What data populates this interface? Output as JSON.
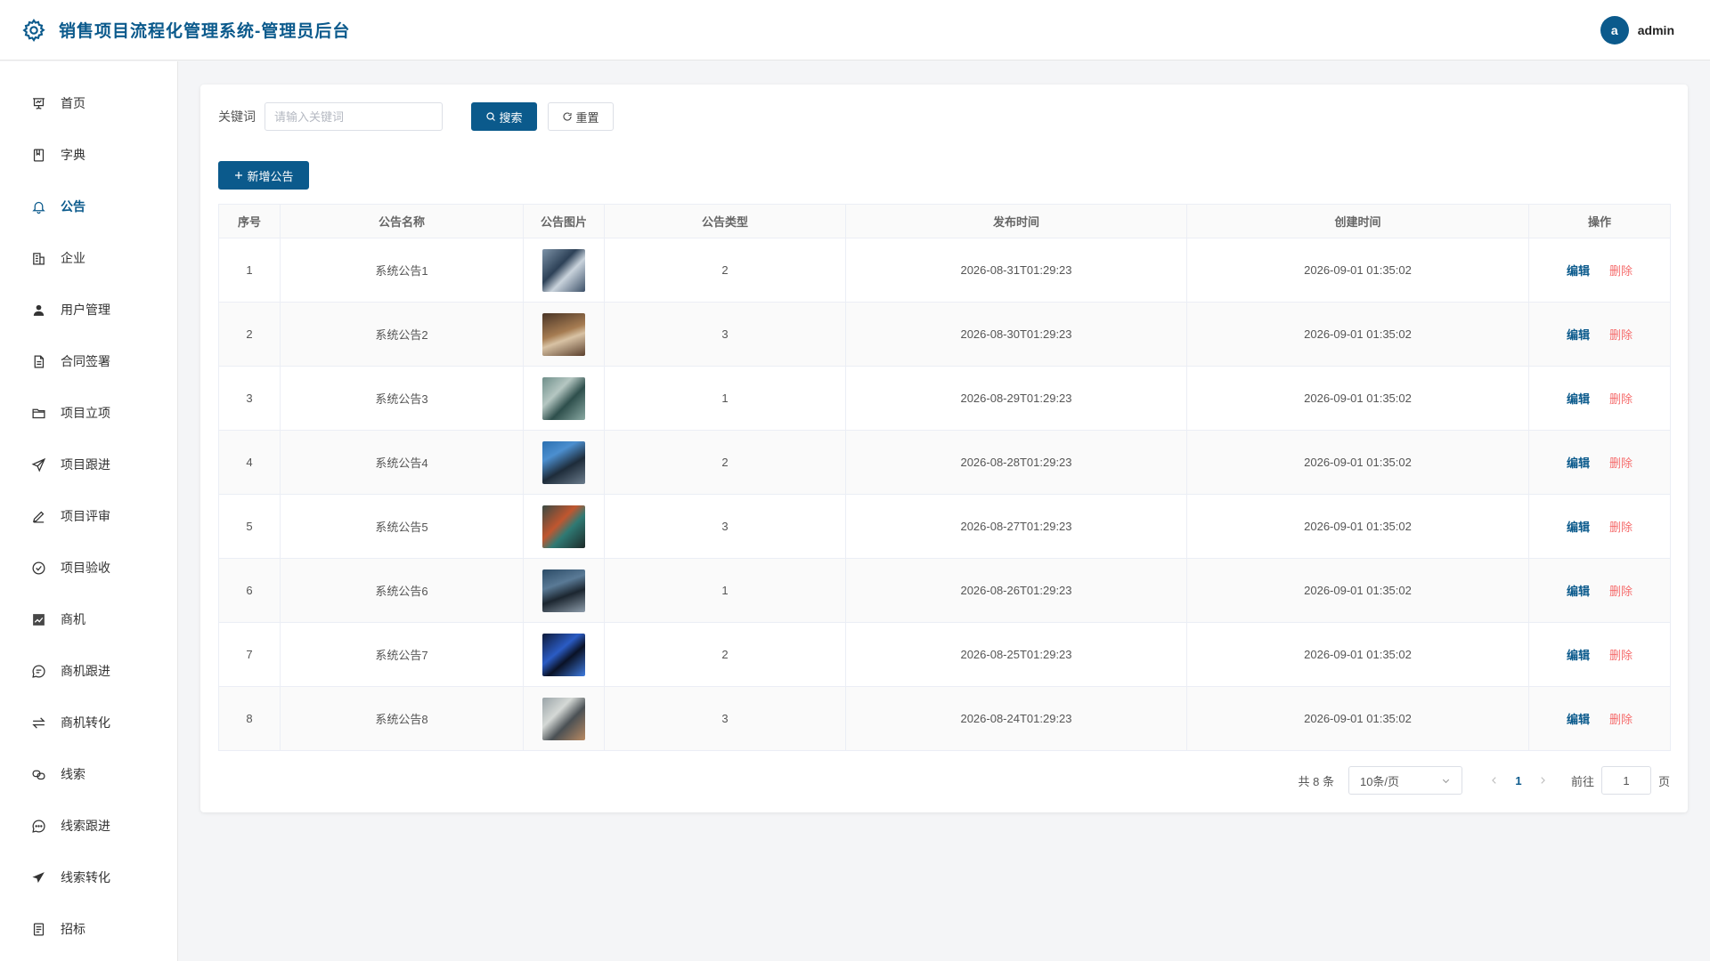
{
  "header": {
    "title": "销售项目流程化管理系统-管理员后台",
    "avatar_letter": "a",
    "username": "admin",
    "brand_color": "#0b5a8c"
  },
  "sidebar": {
    "items": [
      {
        "label": "首页",
        "icon": "presentation-chart-icon"
      },
      {
        "label": "字典",
        "icon": "book-icon"
      },
      {
        "label": "公告",
        "icon": "bell-icon",
        "active": true
      },
      {
        "label": "企业",
        "icon": "building-icon"
      },
      {
        "label": "用户管理",
        "icon": "user-icon"
      },
      {
        "label": "合同签署",
        "icon": "document-icon"
      },
      {
        "label": "项目立项",
        "icon": "folder-icon"
      },
      {
        "label": "项目跟进",
        "icon": "send-icon"
      },
      {
        "label": "项目评审",
        "icon": "edit-pen-icon"
      },
      {
        "label": "项目验收",
        "icon": "circle-check-icon"
      },
      {
        "label": "商机",
        "icon": "trend-chart-icon"
      },
      {
        "label": "商机跟进",
        "icon": "chat-bubble-icon"
      },
      {
        "label": "商机转化",
        "icon": "switch-arrows-icon"
      },
      {
        "label": "线索",
        "icon": "link-icon"
      },
      {
        "label": "线索跟进",
        "icon": "chat-dots-icon"
      },
      {
        "label": "线索转化",
        "icon": "paper-plane-icon"
      },
      {
        "label": "招标",
        "icon": "tickets-icon"
      }
    ]
  },
  "search": {
    "label": "关键词",
    "placeholder": "请输入关键词",
    "value": "",
    "search_button": "搜索",
    "reset_button": "重置"
  },
  "toolbar": {
    "add_button": "新增公告"
  },
  "table": {
    "columns": [
      "序号",
      "公告名称",
      "公告图片",
      "公告类型",
      "发布时间",
      "创建时间",
      "操作"
    ],
    "edit_label": "编辑",
    "delete_label": "删除",
    "rows": [
      {
        "index": "1",
        "name": "系统公告1",
        "type": "2",
        "publish_time": "2026-08-31T01:29:23",
        "create_time": "2026-09-01 01:35:02"
      },
      {
        "index": "2",
        "name": "系统公告2",
        "type": "3",
        "publish_time": "2026-08-30T01:29:23",
        "create_time": "2026-09-01 01:35:02"
      },
      {
        "index": "3",
        "name": "系统公告3",
        "type": "1",
        "publish_time": "2026-08-29T01:29:23",
        "create_time": "2026-09-01 01:35:02"
      },
      {
        "index": "4",
        "name": "系统公告4",
        "type": "2",
        "publish_time": "2026-08-28T01:29:23",
        "create_time": "2026-09-01 01:35:02"
      },
      {
        "index": "5",
        "name": "系统公告5",
        "type": "3",
        "publish_time": "2026-08-27T01:29:23",
        "create_time": "2026-09-01 01:35:02"
      },
      {
        "index": "6",
        "name": "系统公告6",
        "type": "1",
        "publish_time": "2026-08-26T01:29:23",
        "create_time": "2026-09-01 01:35:02"
      },
      {
        "index": "7",
        "name": "系统公告7",
        "type": "2",
        "publish_time": "2026-08-25T01:29:23",
        "create_time": "2026-09-01 01:35:02"
      },
      {
        "index": "8",
        "name": "系统公告8",
        "type": "3",
        "publish_time": "2026-08-24T01:29:23",
        "create_time": "2026-09-01 01:35:02"
      }
    ]
  },
  "pagination": {
    "total": "共 8 条",
    "page_size": "10条/页",
    "current_page": "1",
    "goto_label": "前往",
    "goto_value": "1",
    "page_suffix": "页"
  }
}
